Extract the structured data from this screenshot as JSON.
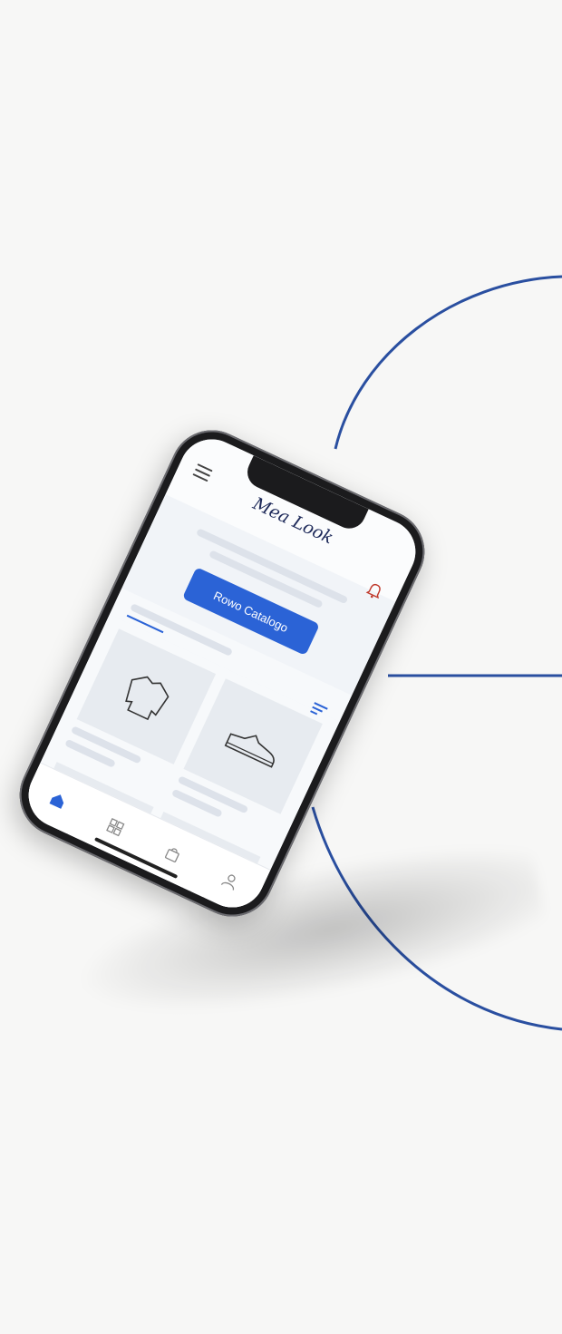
{
  "app": {
    "title": "Mea Look",
    "cta_label": "Rowo Catalogo"
  },
  "colors": {
    "accent": "#2b63d6",
    "decor_line": "#2a4fa0",
    "title_color": "#1e2a5a"
  },
  "icons": {
    "menu": "menu-icon",
    "notifications": "bell-icon",
    "filter": "filter-icon",
    "nav": [
      "home-icon",
      "grid-icon",
      "bag-icon",
      "profile-icon"
    ]
  },
  "products": [
    {
      "icon": "sweater-icon"
    },
    {
      "icon": "sneaker-icon"
    },
    {
      "icon": "tank-top-icon"
    },
    {
      "icon": "shorts-icon"
    }
  ],
  "nav_active": "home"
}
